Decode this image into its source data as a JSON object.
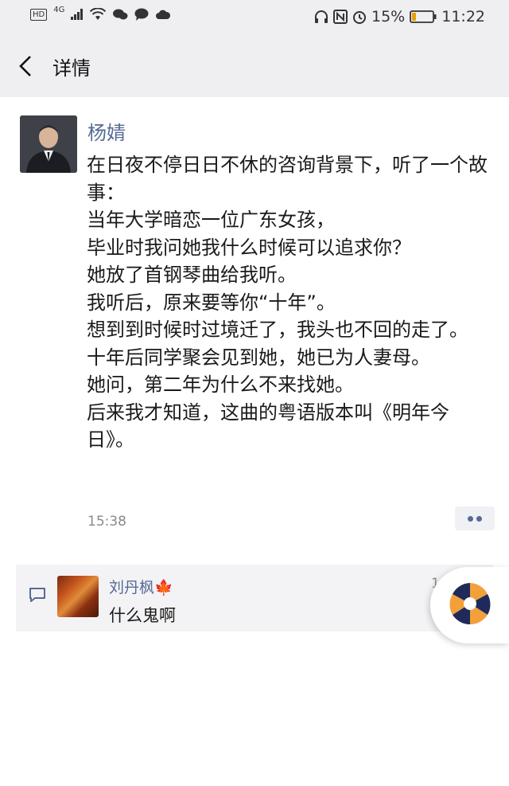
{
  "status_bar": {
    "left_badges": [
      "HD",
      "4G"
    ],
    "battery_percent": "15%",
    "time": "11:22"
  },
  "navbar": {
    "title": "详情"
  },
  "post": {
    "author": "杨婧",
    "text": "在日夜不停日日不休的咨询背景下，听了一个故事：\n当年大学暗恋一位广东女孩，\n毕业时我问她我什么时候可以追求你？\n她放了首钢琴曲给我听。\n我听后，原来要等你“十年”。\n想到到时候时过境迁了，我头也不回的走了。\n十年后同学聚会见到她，她已为人妻母。\n她问，第二年为什么不来找她。\n后来我才知道，这曲的粤语版本叫《明年今日》。",
    "time": "15:38"
  },
  "comments": [
    {
      "name": "刘丹枫🍁",
      "text": "什么鬼啊",
      "time": "1"
    }
  ],
  "colors": {
    "link": "#576b95",
    "header_bg": "#efeff1",
    "comment_bg": "#f3f3f5"
  }
}
